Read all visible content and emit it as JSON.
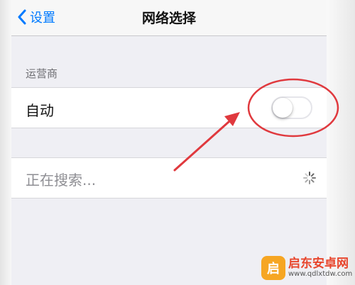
{
  "navbar": {
    "back_label": "设置",
    "title": "网络选择"
  },
  "section": {
    "header": "运营商"
  },
  "auto_cell": {
    "label": "自动",
    "toggle_on": false
  },
  "search_cell": {
    "label": "正在搜索..."
  },
  "annotation": {
    "color": "#e0393e"
  },
  "watermark": {
    "logo_char": "启",
    "name": "启东安卓网",
    "url": "www.qdlxtdw.com"
  },
  "colors": {
    "accent": "#007aff",
    "background": "#efeff4"
  }
}
